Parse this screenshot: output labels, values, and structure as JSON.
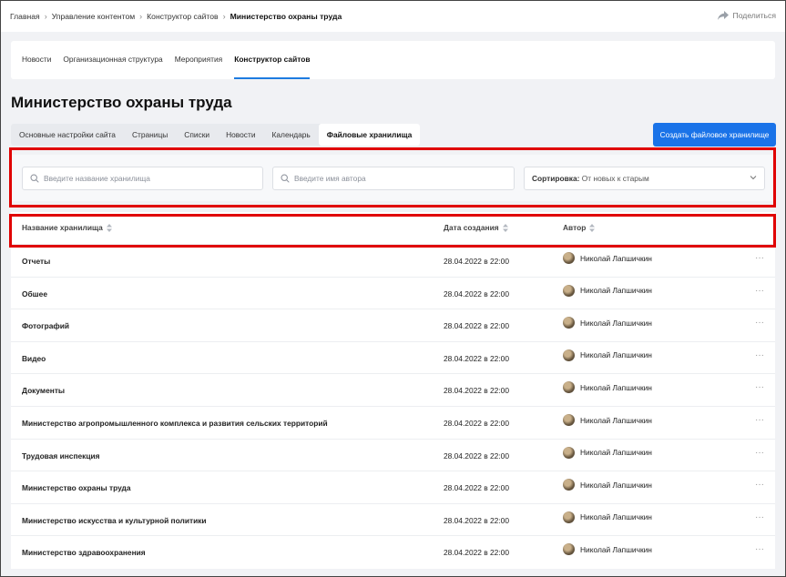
{
  "breadcrumb": {
    "items": [
      "Главная",
      "Управление контентом",
      "Конструктор сайтов",
      "Министерство охраны труда"
    ],
    "share_label": "Поделиться"
  },
  "nav": {
    "tabs": [
      {
        "label": "Новости",
        "active": false
      },
      {
        "label": "Организационная структура",
        "active": false
      },
      {
        "label": "Мероприятия",
        "active": false
      },
      {
        "label": "Конструктор сайтов",
        "active": true
      }
    ]
  },
  "page": {
    "title": "Министерство охраны труда"
  },
  "subtabs": [
    {
      "label": "Основные настройки сайта",
      "active": false
    },
    {
      "label": "Страницы",
      "active": false
    },
    {
      "label": "Списки",
      "active": false
    },
    {
      "label": "Новости",
      "active": false
    },
    {
      "label": "Календарь",
      "active": false
    },
    {
      "label": "Файловые хранилища",
      "active": true
    }
  ],
  "create_button": "Создать файловое хранилище",
  "filters": {
    "name_placeholder": "Введите название хранилища",
    "author_placeholder": "Введите имя автора",
    "sort_label": "Сортировка:",
    "sort_value": "От новых к старым"
  },
  "table": {
    "columns": [
      "Название хранилища",
      "Дата создания",
      "Автор"
    ],
    "rows": [
      {
        "name": "Отчеты",
        "date": "28.04.2022 в 22:00",
        "author": "Николай Лапшичкин"
      },
      {
        "name": "Обшее",
        "date": "28.04.2022 в 22:00",
        "author": "Николай Лапшичкин"
      },
      {
        "name": "Фотографий",
        "date": "28.04.2022 в 22:00",
        "author": "Николай Лапшичкин"
      },
      {
        "name": "Видео",
        "date": "28.04.2022 в 22:00",
        "author": "Николай Лапшичкин"
      },
      {
        "name": "Документы",
        "date": "28.04.2022 в 22:00",
        "author": "Николай Лапшичкин"
      },
      {
        "name": "Министерство агропромышленного комплекса и развития сельских территорий",
        "date": "28.04.2022 в 22:00",
        "author": "Николай Лапшичкин"
      },
      {
        "name": "Трудовая инспекция",
        "date": "28.04.2022 в 22:00",
        "author": "Николай Лапшичкин"
      },
      {
        "name": "Министерство охраны труда",
        "date": "28.04.2022 в 22:00",
        "author": "Николай Лапшичкин"
      },
      {
        "name": "Министерство искусства и культурной политики",
        "date": "28.04.2022 в 22:00",
        "author": "Николай Лапшичкин"
      },
      {
        "name": "Министерство здравоохранения",
        "date": "28.04.2022 в 22:00",
        "author": "Николай Лапшичкин"
      }
    ],
    "more_label": "···"
  },
  "colors": {
    "accent": "#1a73e8",
    "highlight": "#e00000"
  }
}
